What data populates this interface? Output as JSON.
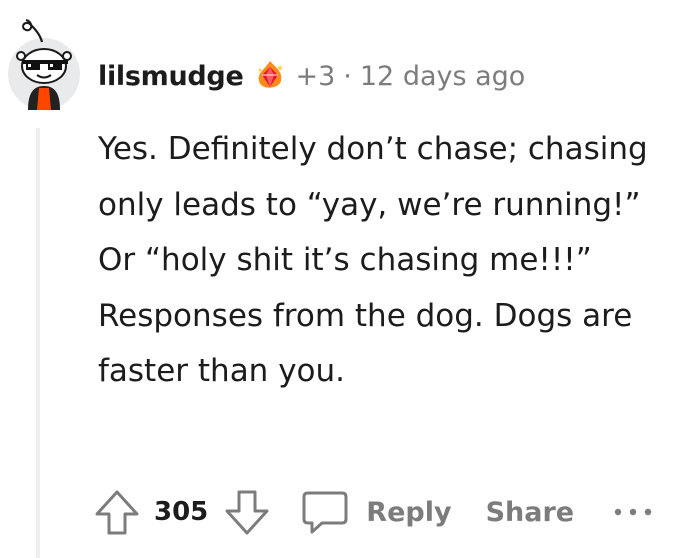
{
  "comment": {
    "username": "lilsmudge",
    "points": "+3",
    "separator": "·",
    "timestamp": "12 days ago",
    "body": "Yes. Definitely don’t chase; chasing only leads to “yay, we’re running!” Or “holy shit it’s chasing me!!!” Responses from the dog. Dogs are faster than you.",
    "icons": {
      "avatar": "snoo-avatar-with-sunglasses",
      "award": "fire-gem-award-icon"
    }
  },
  "actions": {
    "upvote_icon": "upvote-arrow-icon",
    "score": "305",
    "downvote_icon": "downvote-arrow-icon",
    "reply_icon": "speech-bubble-icon",
    "reply_label": "Reply",
    "share_label": "Share",
    "more_icon": "more-dots-icon"
  },
  "colors": {
    "text": "#1c1c1c",
    "muted": "#7c7c7c",
    "thread_line": "#eceeef",
    "avatar_bg": "#e8eaeb",
    "shirt": "#ff4500"
  }
}
